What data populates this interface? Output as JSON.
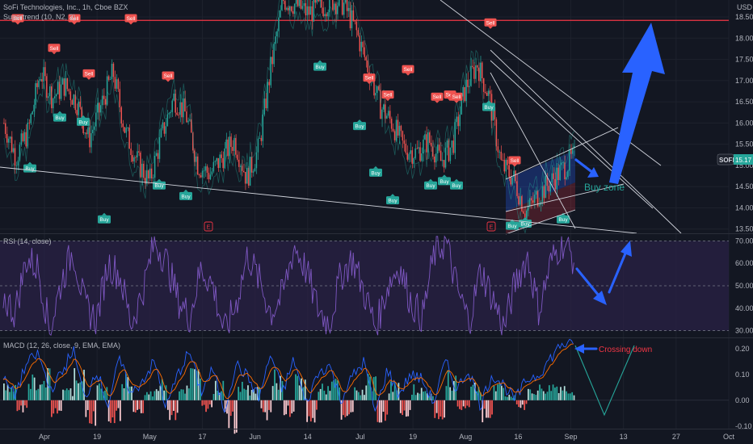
{
  "header": {
    "symbol_title": "SoFi Technologies, Inc., 1h, Cboe BZX",
    "indicator": "Supertrend (10, N2, 3)",
    "currency": "USD"
  },
  "colors": {
    "background": "#131722",
    "grid": "#1e222d",
    "candle_up": "#26a69a",
    "candle_down": "#ef5350",
    "buy_label": "#26a69a",
    "sell_label": "#ef5350",
    "resistance_line": "#f23645",
    "rsi_line": "#7e57c2",
    "rsi_band": "#2a2245",
    "macd_line": "#2962ff",
    "signal_line": "#ff6d00",
    "annotation_arrow": "#2962ff",
    "annotation_text_green": "#26a69a",
    "annotation_text_red": "#f23645"
  },
  "chart_data": [
    {
      "type": "candlestick",
      "pane": "price",
      "title": "SoFi Technologies, Inc., 1h, Cboe BZX",
      "ylim": [
        13.4,
        18.9
      ],
      "y_ticks": [
        "18.50",
        "18.00",
        "17.50",
        "17.00",
        "16.50",
        "16.00",
        "15.50",
        "15.00",
        "14.50",
        "14.00",
        "13.50"
      ],
      "last_price_label": "SOFI",
      "last_price": "15.17",
      "resistance_level": 18.42,
      "close_approx": [
        16.0,
        15.2,
        15.8,
        17.2,
        16.6,
        16.9,
        16.5,
        15.6,
        16.4,
        17.2,
        15.8,
        15.1,
        14.6,
        15.7,
        16.6,
        16.2,
        15.0,
        14.8,
        15.2,
        15.6,
        14.7,
        15.4,
        17.3,
        18.9,
        18.8,
        18.6,
        18.7,
        18.9,
        18.8,
        18.2,
        17.3,
        16.4,
        16.0,
        15.4,
        15.3,
        15.6,
        15.1,
        15.5,
        16.8,
        17.4,
        16.6,
        15.0,
        14.7,
        13.9,
        14.3,
        14.6,
        14.9,
        15.2
      ],
      "buy_signals": [
        {
          "label": "Buy",
          "price": 15.1
        },
        {
          "label": "Buy",
          "price": 16.3
        },
        {
          "label": "Buy",
          "price": 16.2
        },
        {
          "label": "Buy",
          "price": 13.9
        },
        {
          "label": "Buy",
          "price": 14.7
        },
        {
          "label": "Buy",
          "price": 14.45
        },
        {
          "label": "Buy",
          "price": 17.5
        },
        {
          "label": "Buy",
          "price": 16.1
        },
        {
          "label": "Buy",
          "price": 15.0
        },
        {
          "label": "Buy",
          "price": 14.35
        },
        {
          "label": "Buy",
          "price": 14.7
        },
        {
          "label": "Buy",
          "price": 14.8
        },
        {
          "label": "Buy",
          "price": 14.7
        },
        {
          "label": "Buy",
          "price": 16.55
        },
        {
          "label": "Buy",
          "price": 13.75
        },
        {
          "label": "Buy",
          "price": 13.8
        },
        {
          "label": "Buy",
          "price": 13.9
        }
      ],
      "sell_signals": [
        {
          "label": "Sell",
          "price": 18.3
        },
        {
          "label": "Sell",
          "price": 17.6
        },
        {
          "label": "Sell",
          "price": 18.3
        },
        {
          "label": "Sell",
          "price": 17.0
        },
        {
          "label": "Sell",
          "price": 18.3
        },
        {
          "label": "Sell",
          "price": 16.95
        },
        {
          "label": "Sell",
          "price": 16.9
        },
        {
          "label": "Sell",
          "price": 16.5
        },
        {
          "label": "Sell",
          "price": 17.1
        },
        {
          "label": "Sell",
          "price": 16.45
        },
        {
          "label": "Sell",
          "price": 16.5
        },
        {
          "label": "Sell",
          "price": 16.45
        },
        {
          "label": "Sell",
          "price": 18.2
        },
        {
          "label": "Sell",
          "price": 14.95
        }
      ],
      "annotations": [
        {
          "text": "Buy zone"
        }
      ],
      "earnings_markers": [
        "E",
        "E"
      ]
    },
    {
      "type": "line",
      "pane": "rsi",
      "title": "RSI (14, close)",
      "ylim": [
        27,
        73
      ],
      "y_ticks": [
        "70.00",
        "60.00",
        "50.00",
        "40.00",
        "30.00"
      ],
      "band": [
        30,
        70
      ],
      "values_approx": [
        45,
        38,
        62,
        58,
        30,
        52,
        66,
        41,
        35,
        60,
        55,
        33,
        48,
        70,
        61,
        44,
        36,
        58,
        50,
        29,
        42,
        64,
        52,
        38,
        46,
        68,
        57,
        40,
        33,
        55,
        62,
        47,
        31,
        50,
        59,
        43,
        36,
        64,
        70,
        48,
        34,
        57,
        45,
        31,
        52,
        63,
        39,
        60,
        70,
        62
      ]
    },
    {
      "type": "bar+line",
      "pane": "macd",
      "title": "MACD (12, 26, close, 9, EMA, EMA)",
      "ylim": [
        -0.11,
        0.24
      ],
      "y_ticks": [
        "0.20",
        "0.10",
        "0.00",
        "-0.10"
      ],
      "histogram_approx": [
        0.05,
        -0.04,
        0.08,
        0.1,
        -0.06,
        0.04,
        0.12,
        -0.08,
        0.06,
        -0.07,
        0.09,
        -0.05,
        0.03,
        0.07,
        -0.09,
        0.05,
        0.11,
        -0.04,
        0.06,
        -0.1,
        0.08,
        0.04,
        -0.06,
        0.1,
        -0.05,
        0.09,
        -0.08,
        0.05,
        0.07,
        -0.06,
        0.04,
        0.08,
        -0.1,
        0.06,
        -0.05,
        0.05,
        0.03,
        -0.07,
        0.09,
        -0.04,
        0.06,
        -0.08,
        0.05,
        0.02,
        -0.03,
        0.04,
        0.05,
        0.06,
        0.05,
        0.04
      ],
      "macd_approx": [
        0.08,
        0.02,
        0.14,
        0.18,
        0.04,
        0.1,
        0.2,
        0.0,
        0.12,
        -0.02,
        0.16,
        0.02,
        0.08,
        0.15,
        -0.03,
        0.1,
        0.19,
        0.03,
        0.12,
        -0.04,
        0.14,
        0.09,
        0.01,
        0.18,
        0.03,
        0.16,
        -0.02,
        0.1,
        0.14,
        0.0,
        0.09,
        0.15,
        -0.05,
        0.12,
        0.02,
        0.1,
        0.08,
        -0.01,
        0.15,
        0.04,
        0.12,
        -0.02,
        0.1,
        0.06,
        0.0,
        0.08,
        0.1,
        0.16,
        0.22,
        0.21
      ],
      "annotations": [
        {
          "text": "Crossing down"
        }
      ]
    }
  ],
  "x_axis": {
    "labels": [
      "Apr",
      "19",
      "May",
      "17",
      "Jun",
      "14",
      "Jul",
      "19",
      "Aug",
      "16",
      "Sep",
      "13",
      "27",
      "Oct"
    ]
  }
}
